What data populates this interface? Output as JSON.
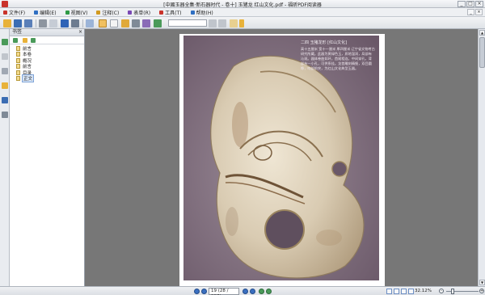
{
  "window": {
    "title": "[中國玉器全集·新石器时代 - 卷十] 玉猪龙 红山文化.pdf - 福昕PDF阅读器",
    "controls": [
      "_",
      "□",
      "×"
    ]
  },
  "menu": {
    "items": [
      "文件(F)",
      "编辑(E)",
      "视图(V)",
      "注释(C)",
      "表单(R)",
      "工具(T)",
      "帮助(H)"
    ],
    "colors": [
      "#c9332b",
      "#2f6fc2",
      "#2f9a45",
      "#d29a20",
      "#7a49b4",
      "#c9332b",
      "#2f6fc2"
    ]
  },
  "toolbar": {
    "search_placeholder": ""
  },
  "bookmarks_panel": {
    "title": "书签",
    "close_label": "×",
    "items": [
      {
        "label": "前言",
        "active": false
      },
      {
        "label": "本卷",
        "active": false
      },
      {
        "label": "概况",
        "active": false
      },
      {
        "label": "前言",
        "active": false
      },
      {
        "label": "目录",
        "active": false
      },
      {
        "label": "正文",
        "active": true
      }
    ]
  },
  "document": {
    "caption_title": "二四 玉猪龙形 [红山文化]",
    "caption_body": "高十五厘米 宽十一厘米 厚四厘米 辽宁省文物考古研究所藏。此器为黄绿色玉，质地温润，局部有沁斑。器体卷曲如环，首尾相连，中间穿孔，背部有一小孔，可供系挂。龙首雕刻精细，双目圆睁，吻部前突，为红山文化典型玉器。"
  },
  "status": {
    "page_indicator": "19 (28 / 997)",
    "zoom_label": "32.12%"
  }
}
